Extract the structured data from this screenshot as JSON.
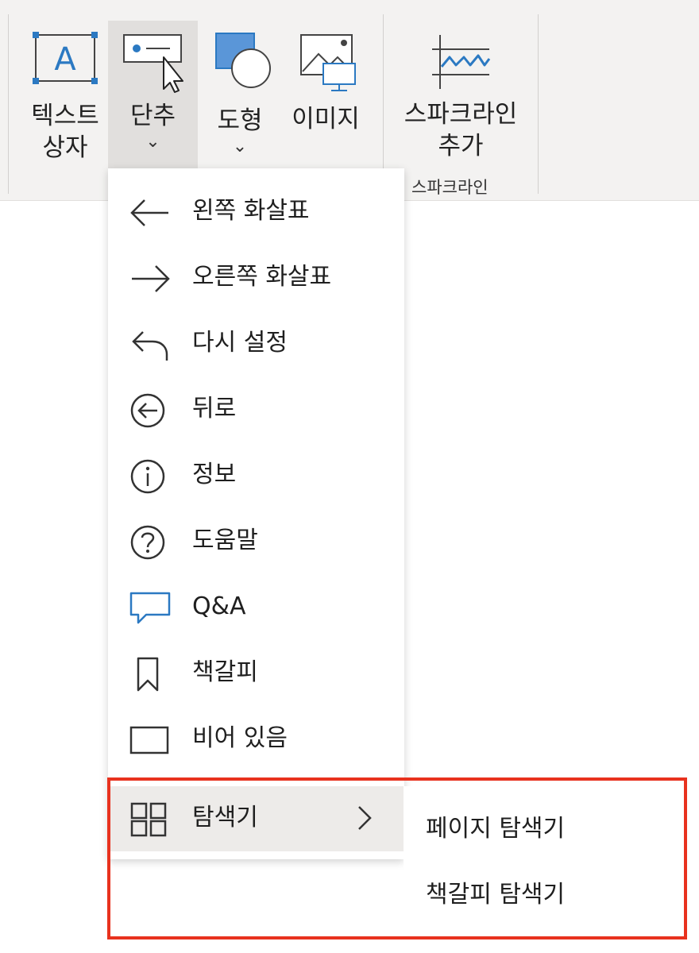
{
  "ribbon": {
    "textbox": {
      "line1": "텍스트",
      "line2": "상자"
    },
    "button": {
      "label": "단추",
      "chevron": "⌄"
    },
    "shapes": {
      "label": "도형",
      "chevron": "⌄"
    },
    "image": {
      "label": "이미지"
    },
    "sparkline": {
      "line1": "스파크라인",
      "line2": "추가",
      "group_label": "스파크라인"
    }
  },
  "menu": {
    "items": [
      {
        "label": "왼쪽 화살표",
        "icon": "arrow-left-icon"
      },
      {
        "label": "오른쪽 화살표",
        "icon": "arrow-right-icon"
      },
      {
        "label": "다시 설정",
        "icon": "reset-icon"
      },
      {
        "label": "뒤로",
        "icon": "back-circle-icon"
      },
      {
        "label": "정보",
        "icon": "info-icon"
      },
      {
        "label": "도움말",
        "icon": "help-icon"
      },
      {
        "label": "Q&A",
        "icon": "qna-icon"
      },
      {
        "label": "책갈피",
        "icon": "bookmark-icon"
      },
      {
        "label": "비어 있음",
        "icon": "blank-icon"
      },
      {
        "label": "탐색기",
        "icon": "navigator-icon",
        "has_submenu": true
      }
    ]
  },
  "submenu": {
    "items": [
      {
        "label": "페이지 탐색기"
      },
      {
        "label": "책갈피 탐색기"
      }
    ]
  },
  "colors": {
    "accent_blue": "#2b79c2",
    "highlight_red": "#e8321e",
    "ribbon_bg": "#f3f2f1"
  }
}
